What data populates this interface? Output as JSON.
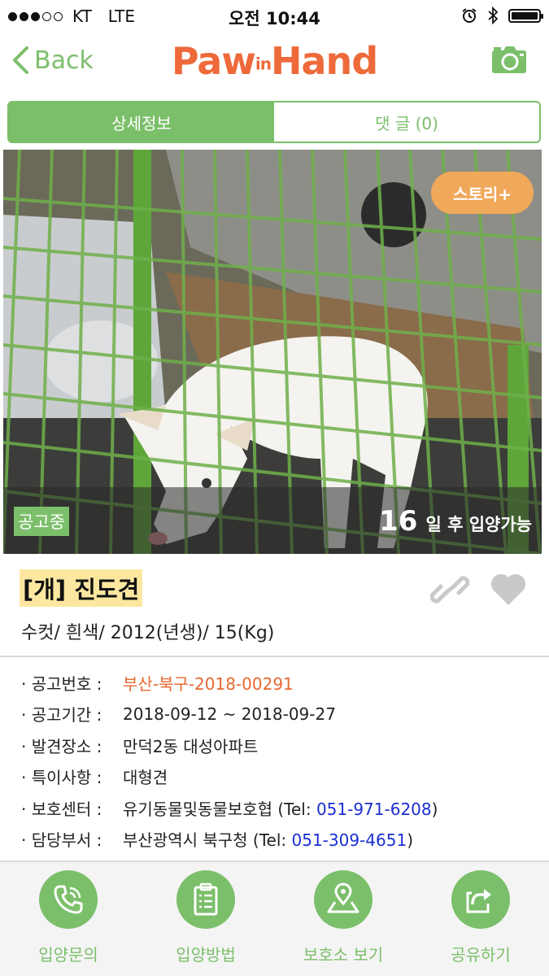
{
  "status_bar": {
    "carrier": "KT",
    "network": "LTE",
    "time": "오전 10:44"
  },
  "nav": {
    "back_label": "Back",
    "logo_text_left": "Paw",
    "logo_text_mid": "in",
    "logo_text_right": "Hand"
  },
  "tabs": [
    {
      "label": "상세정보",
      "active": true
    },
    {
      "label": "댓 글 (0)",
      "active": false
    }
  ],
  "photo": {
    "story_button": "스토리+",
    "status_badge": "공고중",
    "days_number": "16",
    "days_text": "일 후 입양가능"
  },
  "animal": {
    "breed": "[개] 진도견",
    "summary": "수컷/ 흰색/ 2012(년생)/ 15(Kg)"
  },
  "details": [
    {
      "label": "· 공고번호 :",
      "value": "부산-북구-2018-00291"
    },
    {
      "label": "· 공고기간 :",
      "value": "2018-09-12 ~ 2018-09-27"
    },
    {
      "label": "· 발견장소 :",
      "value": "만덕2동 대성아파트"
    },
    {
      "label": "· 특이사항 :",
      "value": "대형견"
    },
    {
      "label": "· 보호센터 :",
      "value": "유기동물및동물보호협 (Tel: ",
      "tel": "051-971-6208",
      "suffix": ")"
    },
    {
      "label": "· 담당부서 :",
      "value": "부산광역시 북구청 (Tel: ",
      "tel": "051-309-4651",
      "suffix": ")"
    }
  ],
  "bottom_nav": [
    {
      "label": "입양문의",
      "icon": "phone-icon"
    },
    {
      "label": "입양방법",
      "icon": "clipboard-icon"
    },
    {
      "label": "보호소 보기",
      "icon": "map-pin-icon"
    },
    {
      "label": "공유하기",
      "icon": "share-icon"
    }
  ],
  "colors": {
    "accent_green": "#7cbf6b",
    "logo_orange": "#ee6a3b",
    "story_orange": "#f0a85a",
    "tel_blue": "#1a2fd1",
    "breed_highlight": "#fde7a0"
  }
}
